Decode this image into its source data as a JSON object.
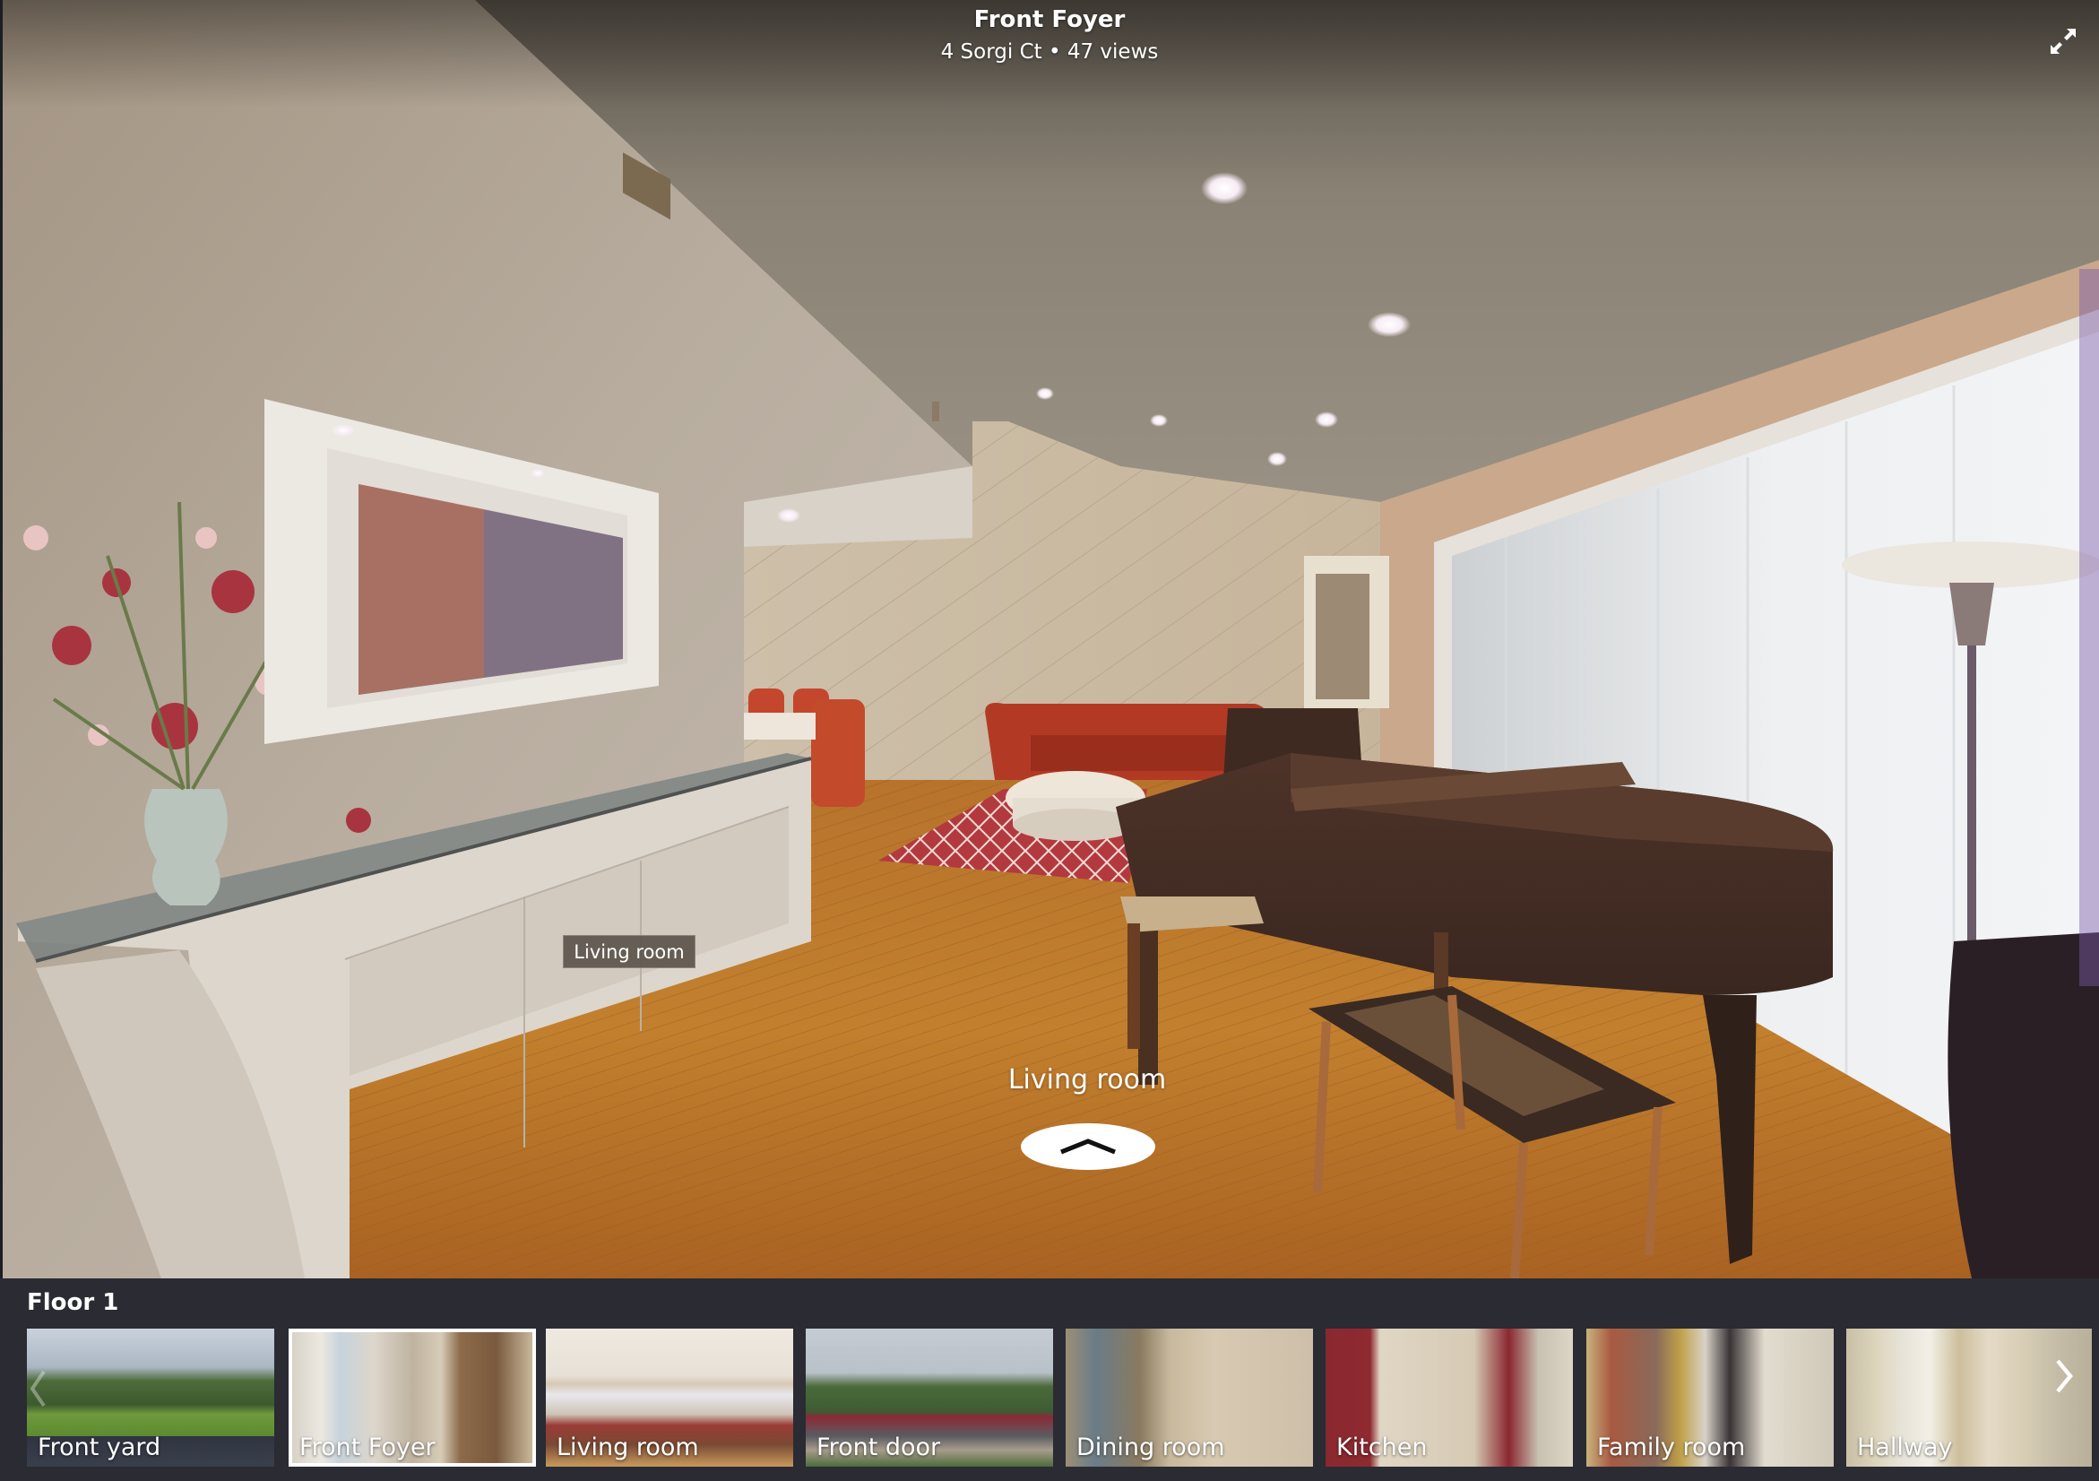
{
  "viewer": {
    "title": "Front Foyer",
    "subtitle": "4 Sorgi Ct • 47 views",
    "fullscreen_icon": "expand-arrows-icon"
  },
  "scene": {
    "tooltip": "Living room",
    "hotspot": {
      "label": "Living room",
      "icon": "chevron-up-icon"
    }
  },
  "panel": {
    "floor_label": "Floor 1",
    "prev_icon": "chevron-left-icon",
    "next_icon": "chevron-right-icon",
    "thumbnails": [
      {
        "label": "Front yard",
        "active": false
      },
      {
        "label": "Front Foyer",
        "active": true
      },
      {
        "label": "Living room",
        "active": false
      },
      {
        "label": "Front door",
        "active": false
      },
      {
        "label": "Dining room",
        "active": false
      },
      {
        "label": "Kitchen",
        "active": false
      },
      {
        "label": "Family room",
        "active": false
      },
      {
        "label": "Hallway",
        "active": false
      }
    ]
  },
  "colors": {
    "panel_bg": "#2a2b33",
    "active_border": "#ffffff",
    "tooltip_bg": "#5c544c"
  }
}
